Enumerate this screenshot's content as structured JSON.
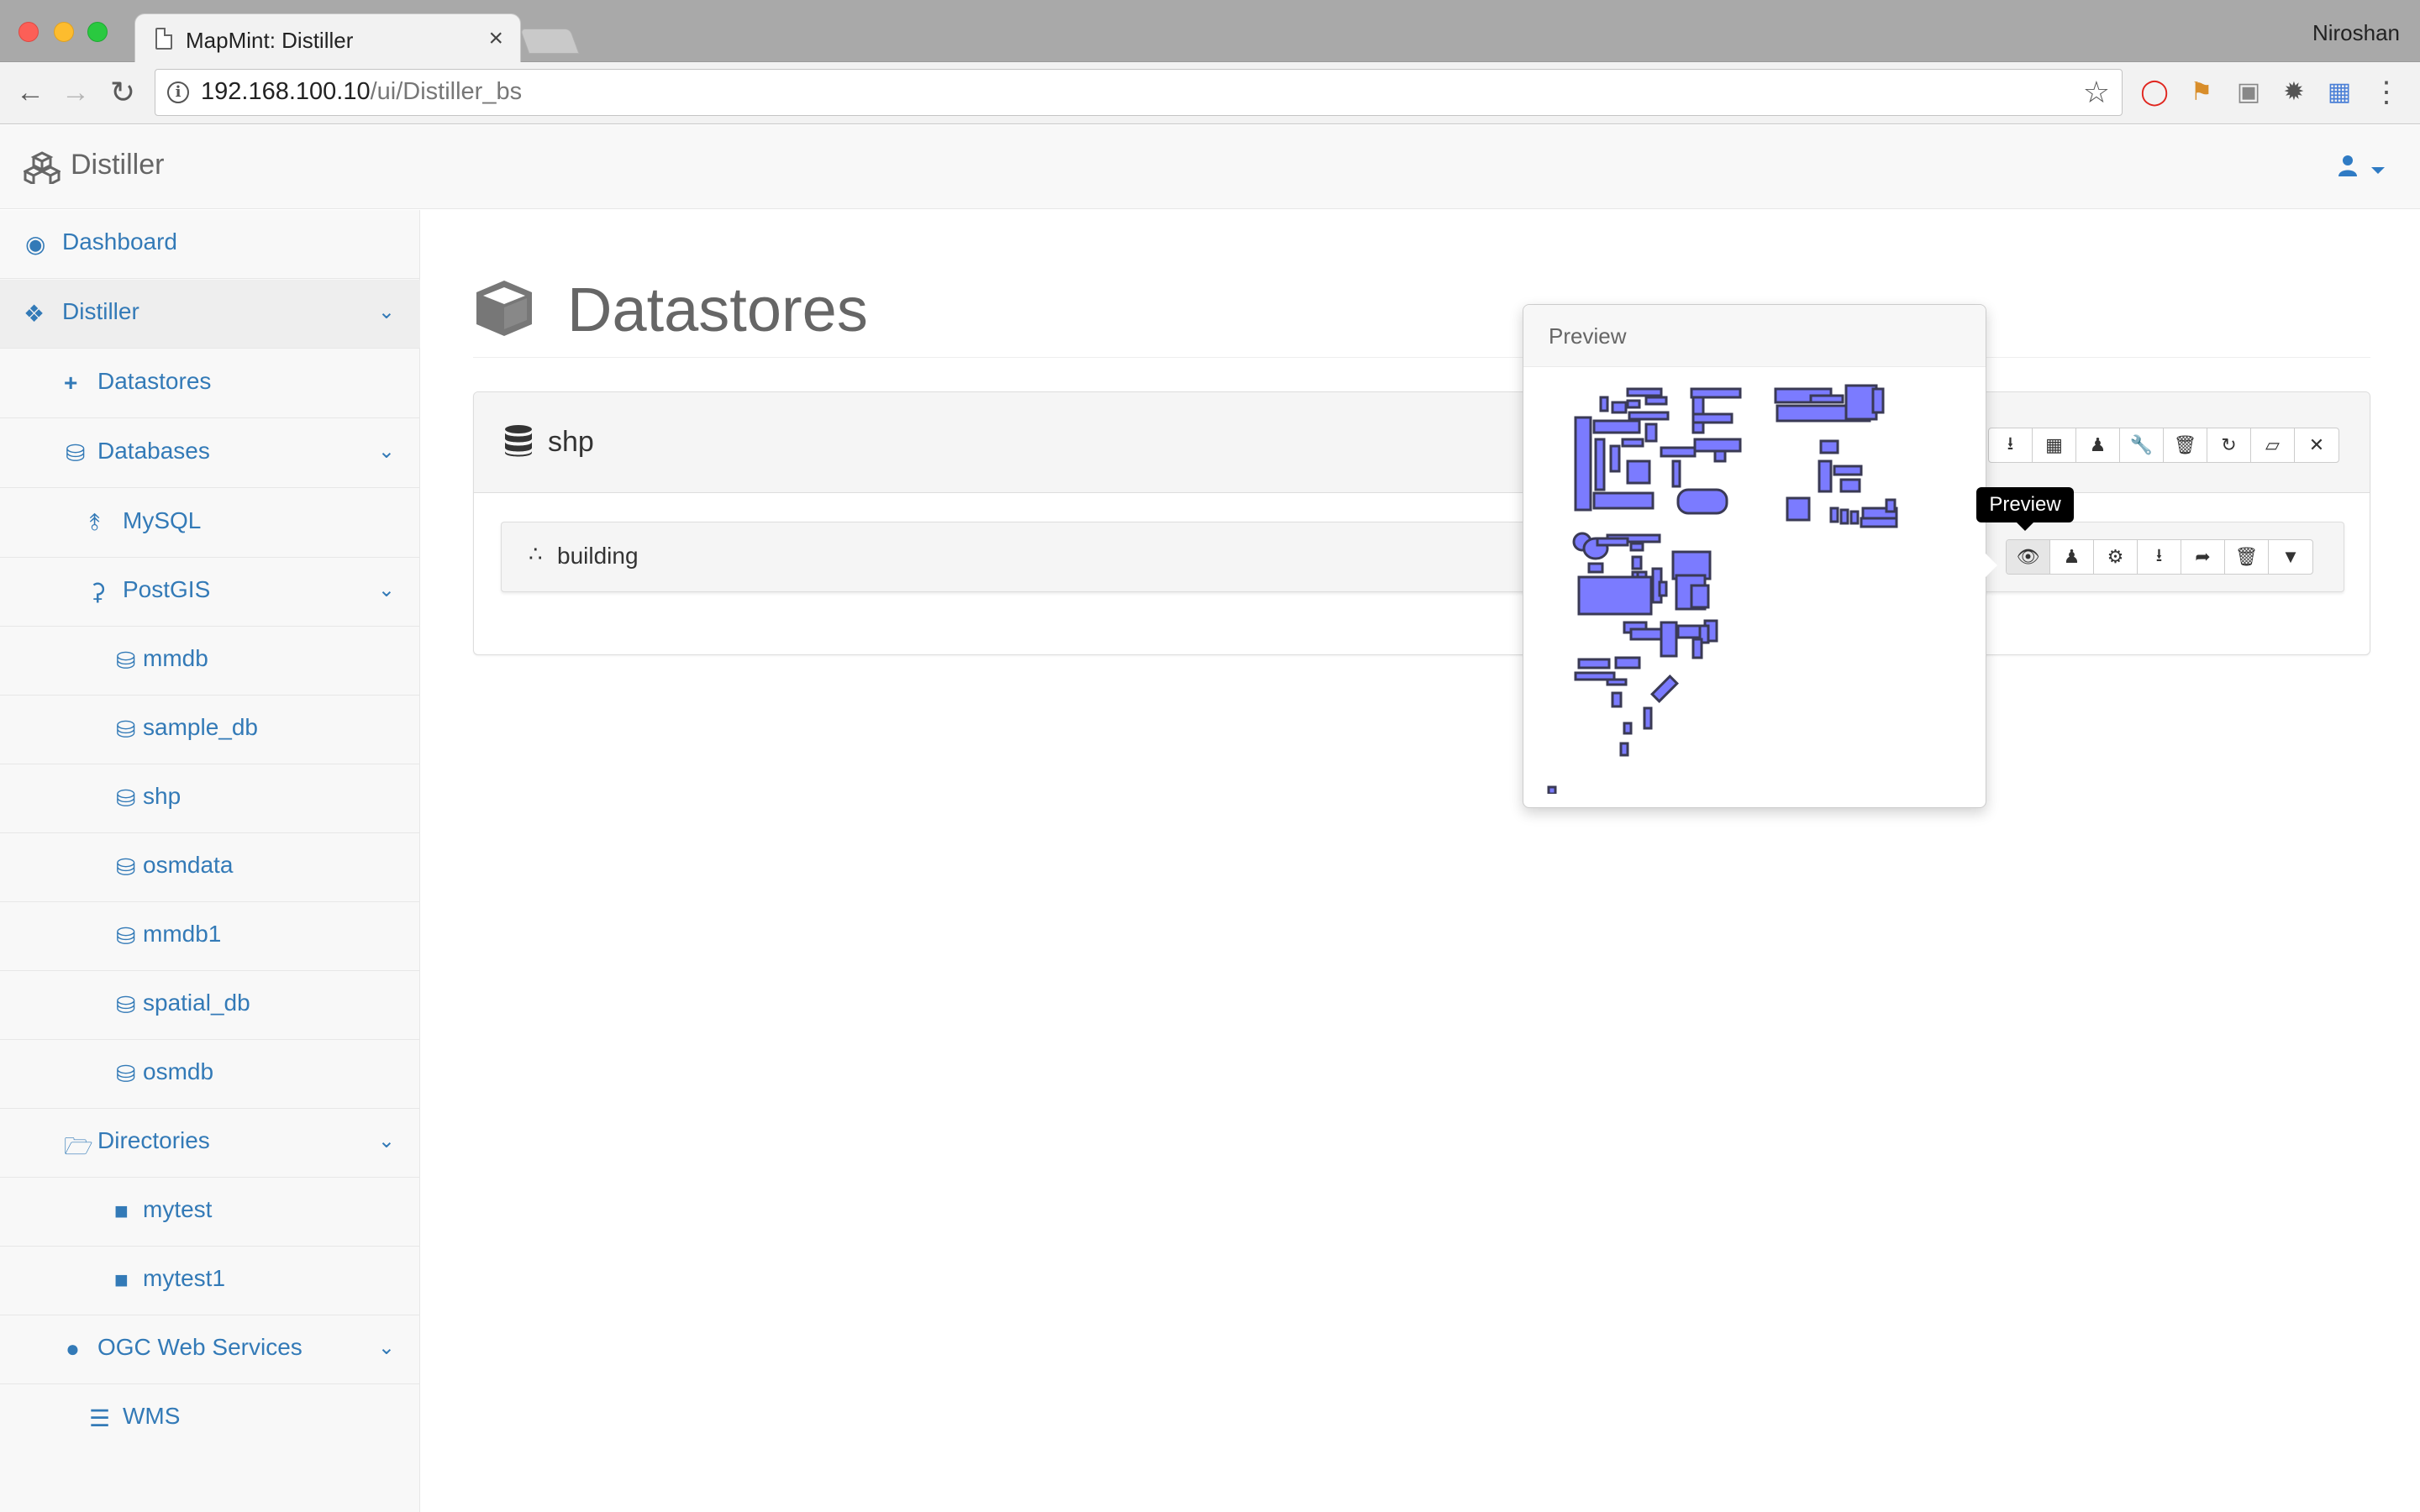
{
  "browser": {
    "tab_title": "MapMint: Distiller",
    "tab_close": "×",
    "profile": "Niroshan",
    "url_host": "192.168.100.10",
    "url_path": "/ui/Distiller_bs"
  },
  "app": {
    "brand": "Distiller",
    "page_title": "Datastores"
  },
  "sidebar": {
    "dashboard": "Dashboard",
    "distiller": "Distiller",
    "datastores": "Datastores",
    "databases": "Databases",
    "mysql": "MySQL",
    "postgis": "PostGIS",
    "db_items": [
      "mmdb",
      "sample_db",
      "shp",
      "osmdata",
      "mmdb1",
      "spatial_db",
      "osmdb"
    ],
    "directories": "Directories",
    "dir_items": [
      "mytest",
      "mytest1"
    ],
    "ogc": "OGC Web Services",
    "wms": "WMS"
  },
  "panel": {
    "title": "shp",
    "layer": "building"
  },
  "popover": {
    "title": "Preview"
  },
  "tooltip": "Preview",
  "colors": {
    "link": "#337ab7",
    "preview_fill": "#7b7bff",
    "preview_stroke": "#3a3a55"
  }
}
